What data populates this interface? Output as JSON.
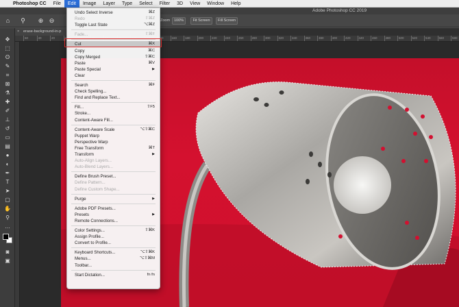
{
  "menubar": {
    "apple_glyph": "",
    "app_name": "Photoshop CC",
    "items": [
      "File",
      "Edit",
      "Image",
      "Layer",
      "Type",
      "Select",
      "Filter",
      "3D",
      "View",
      "Window",
      "Help"
    ],
    "active_item": "Edit"
  },
  "window": {
    "title": "Adobe Photoshop CC 2019"
  },
  "options_bar": {
    "zoom_label": "Zoom",
    "zoom_value": "100%",
    "fit_screen": "Fit Screen",
    "fill_screen": "Fill Screen"
  },
  "document_tab": {
    "name": "erase-background-in-p",
    "close": "×"
  },
  "ruler_ticks": [
    "60",
    "40",
    "20",
    "0",
    "20",
    "40",
    "60",
    "80",
    "100",
    "120",
    "140",
    "160",
    "180",
    "200",
    "220",
    "240",
    "260",
    "280",
    "300",
    "320",
    "340",
    "360",
    "380",
    "400",
    "420",
    "440",
    "460",
    "480",
    "500",
    "520",
    "540",
    "560",
    "580"
  ],
  "toolbox": {
    "tools": [
      "move-tool",
      "marquee-tool",
      "lasso-tool",
      "quick-select-tool",
      "crop-tool",
      "eyedropper-tool",
      "healing-tool",
      "brush-tool",
      "stamp-tool",
      "history-brush-tool",
      "eraser-tool",
      "gradient-tool",
      "blur-tool",
      "dodge-tool",
      "pen-tool",
      "type-tool",
      "path-select-tool",
      "shape-tool",
      "hand-tool",
      "zoom-tool",
      "more-tools"
    ]
  },
  "edit_menu": {
    "items": [
      {
        "label": "Undo Select Inverse",
        "shortcut": "⌘Z",
        "enabled": true
      },
      {
        "label": "Redo",
        "shortcut": "⇧⌘Z",
        "enabled": false
      },
      {
        "label": "Toggle Last State",
        "shortcut": "⌥⌘Z",
        "enabled": true
      },
      {
        "sep": true
      },
      {
        "label": "Fade...",
        "shortcut": "⇧⌘F",
        "enabled": false
      },
      {
        "sep": true
      },
      {
        "label": "Cut",
        "shortcut": "⌘X",
        "enabled": true,
        "highlighted": true
      },
      {
        "label": "Copy",
        "shortcut": "⌘C",
        "enabled": true
      },
      {
        "label": "Copy Merged",
        "shortcut": "⇧⌘C",
        "enabled": true
      },
      {
        "label": "Paste",
        "shortcut": "⌘V",
        "enabled": true
      },
      {
        "label": "Paste Special",
        "submenu": true,
        "enabled": true
      },
      {
        "label": "Clear",
        "enabled": true
      },
      {
        "sep": true
      },
      {
        "label": "Search",
        "shortcut": "⌘F",
        "enabled": true
      },
      {
        "label": "Check Spelling...",
        "enabled": true
      },
      {
        "label": "Find and Replace Text...",
        "enabled": true
      },
      {
        "sep": true
      },
      {
        "label": "Fill...",
        "shortcut": "⇧F5",
        "enabled": true
      },
      {
        "label": "Stroke...",
        "enabled": true
      },
      {
        "label": "Content-Aware Fill...",
        "enabled": true
      },
      {
        "sep": true
      },
      {
        "label": "Content-Aware Scale",
        "shortcut": "⌥⇧⌘C",
        "enabled": true
      },
      {
        "label": "Puppet Warp",
        "enabled": true
      },
      {
        "label": "Perspective Warp",
        "enabled": true
      },
      {
        "label": "Free Transform",
        "shortcut": "⌘T",
        "enabled": true
      },
      {
        "label": "Transform",
        "submenu": true,
        "enabled": true
      },
      {
        "label": "Auto-Align Layers...",
        "enabled": false
      },
      {
        "label": "Auto-Blend Layers...",
        "enabled": false
      },
      {
        "sep": true
      },
      {
        "label": "Define Brush Preset...",
        "enabled": true
      },
      {
        "label": "Define Pattern...",
        "enabled": false
      },
      {
        "label": "Define Custom Shape...",
        "enabled": false
      },
      {
        "sep": true
      },
      {
        "label": "Purge",
        "submenu": true,
        "enabled": true
      },
      {
        "sep": true
      },
      {
        "label": "Adobe PDF Presets...",
        "enabled": true
      },
      {
        "label": "Presets",
        "submenu": true,
        "enabled": true
      },
      {
        "label": "Remote Connections...",
        "enabled": true
      },
      {
        "sep": true
      },
      {
        "label": "Color Settings...",
        "shortcut": "⇧⌘K",
        "enabled": true
      },
      {
        "label": "Assign Profile...",
        "enabled": true
      },
      {
        "label": "Convert to Profile...",
        "enabled": true
      },
      {
        "sep": true
      },
      {
        "label": "Keyboard Shortcuts...",
        "shortcut": "⌥⇧⌘K",
        "enabled": true
      },
      {
        "label": "Menus...",
        "shortcut": "⌥⇧⌘M",
        "enabled": true
      },
      {
        "label": "Toolbar...",
        "enabled": true
      },
      {
        "sep": true
      },
      {
        "label": "Start Dictation...",
        "shortcut": "fn fn",
        "enabled": true
      }
    ]
  },
  "colors": {
    "menu_highlight": "#2b6ed8",
    "cut_outline": "#d92b2b",
    "photo_background": "#cf102c"
  }
}
